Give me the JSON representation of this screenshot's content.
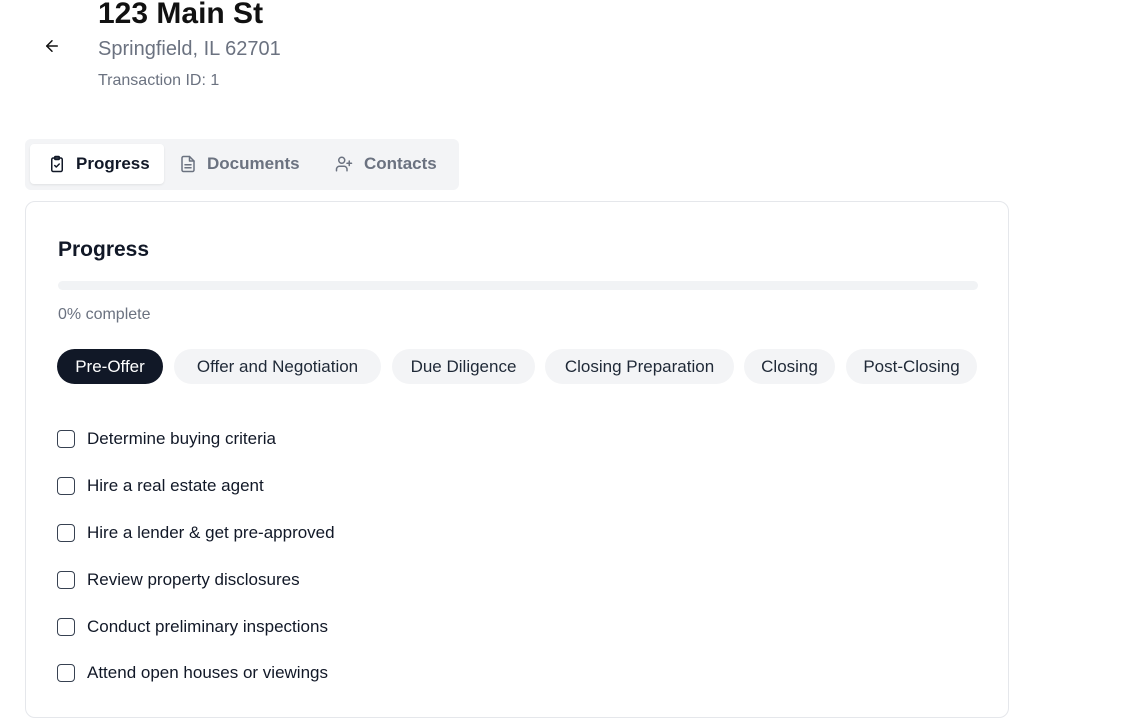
{
  "header": {
    "title": "123 Main St",
    "subtitle": "Springfield, IL 62701",
    "transaction": "Transaction ID: 1"
  },
  "tabs": [
    {
      "label": "Progress",
      "icon": "clipboard-check-icon",
      "active": true
    },
    {
      "label": "Documents",
      "icon": "file-text-icon",
      "active": false
    },
    {
      "label": "Contacts",
      "icon": "user-plus-icon",
      "active": false
    }
  ],
  "progress": {
    "title": "Progress",
    "percent": 0,
    "percent_text": "0% complete"
  },
  "stages": [
    {
      "label": "Pre-Offer",
      "active": true
    },
    {
      "label": "Offer and Negotiation",
      "active": false
    },
    {
      "label": "Due Diligence",
      "active": false
    },
    {
      "label": "Closing Preparation",
      "active": false
    },
    {
      "label": "Closing",
      "active": false
    },
    {
      "label": "Post-Closing",
      "active": false
    }
  ],
  "tasks": [
    {
      "label": "Determine buying criteria",
      "checked": false
    },
    {
      "label": "Hire a real estate agent",
      "checked": false
    },
    {
      "label": "Hire a lender & get pre-approved",
      "checked": false
    },
    {
      "label": "Review property disclosures",
      "checked": false
    },
    {
      "label": "Conduct preliminary inspections",
      "checked": false
    },
    {
      "label": "Attend open houses or viewings",
      "checked": false
    }
  ],
  "colors": {
    "accent": "#111827",
    "muted": "#6b7280",
    "surface": "#f3f4f6"
  }
}
